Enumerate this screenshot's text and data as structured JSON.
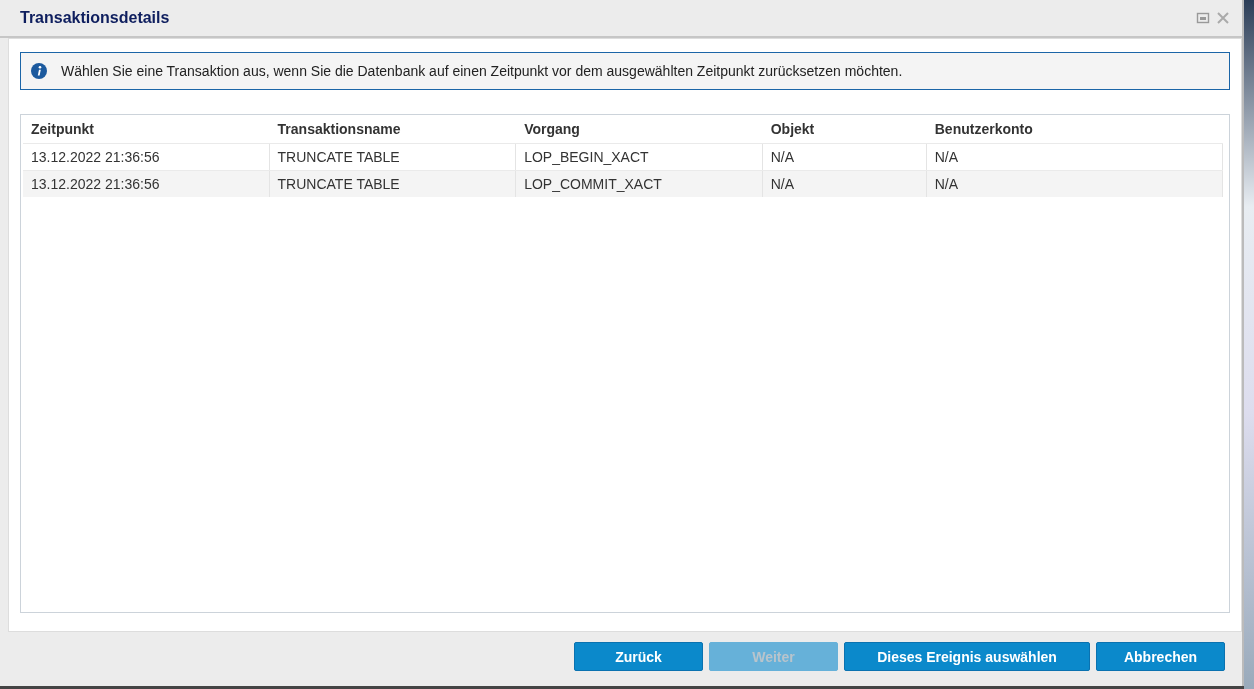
{
  "window": {
    "title": "Transaktionsdetails"
  },
  "info": {
    "text": "Wählen Sie eine Transaktion aus, wenn Sie die Datenbank auf einen Zeitpunkt vor dem ausgewählten Zeitpunkt zurücksetzen möchten."
  },
  "table": {
    "columns": [
      "Zeitpunkt",
      "Transaktionsname",
      "Vorgang",
      "Objekt",
      "Benutzerkonto"
    ],
    "rows": [
      {
        "cells": [
          "13.12.2022 21:36:56",
          "TRUNCATE TABLE",
          "LOP_BEGIN_XACT",
          "N/A",
          "N/A"
        ]
      },
      {
        "cells": [
          "13.12.2022 21:36:56",
          "TRUNCATE TABLE",
          "LOP_COMMIT_XACT",
          "N/A",
          "N/A"
        ]
      }
    ]
  },
  "buttons": [
    {
      "label": "Zurück",
      "disabled": false
    },
    {
      "label": "Weiter",
      "disabled": true
    },
    {
      "label": "Dieses Ereignis auswählen",
      "disabled": false
    },
    {
      "label": "Abbrechen",
      "disabled": false
    }
  ]
}
